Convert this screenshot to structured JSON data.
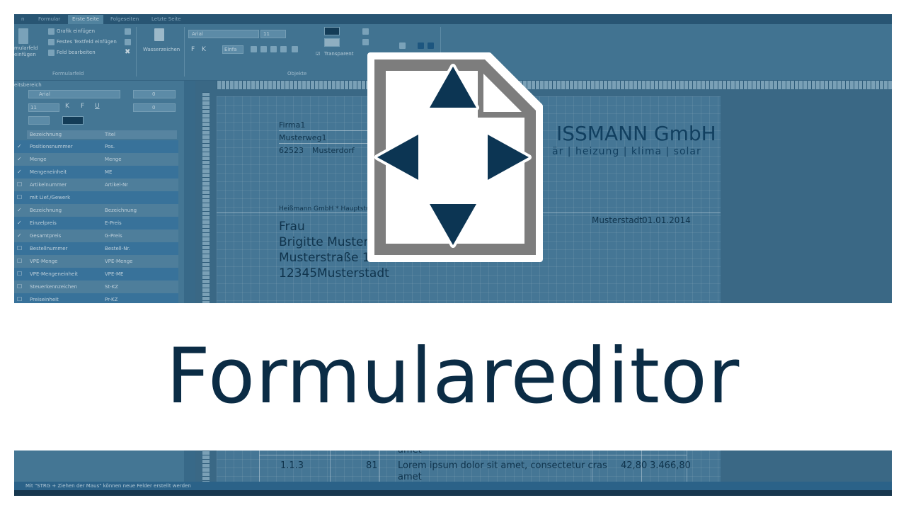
{
  "tabs": [
    "Formular",
    "Erste Seite",
    "Folgeseiten",
    "Letzte Seite"
  ],
  "ribbon": {
    "formularfeld_label": "Formularfeld",
    "insert_formfield": "mularfeld\neinfügen",
    "grafik_einfuegen": "Grafik einfügen",
    "festes_textfeld": "Festes Textfeld einfügen",
    "feld_bearbeiten": "Feld bearbeiten",
    "wasserzeichen": "Wasserzeichen",
    "font_name": "Arial",
    "font_size": "11",
    "bold": "F",
    "italic": "K",
    "underline": "U",
    "einfa": "Einfa",
    "transparent": "Transparent",
    "objekte_label": "Objekte"
  },
  "left_panel": {
    "title": "eitsbereich",
    "font_name": "Arial",
    "font_size": "11",
    "bold": "F",
    "italic": "K",
    "underline": "U",
    "spinner_value_1": "0",
    "spinner_value_2": "0",
    "header_col1": "Bezeichnung",
    "header_col2": "Titel",
    "rows": [
      {
        "name": "Positionsnummer",
        "title": "Pos.",
        "checked": true
      },
      {
        "name": "Menge",
        "title": "Menge",
        "checked": true
      },
      {
        "name": "Mengeneinheit",
        "title": "ME",
        "checked": true
      },
      {
        "name": "Artikelnummer",
        "title": "Artikel-Nr",
        "checked": false
      },
      {
        "name": "mit Lief./Gewerk",
        "title": "",
        "checked": false
      },
      {
        "name": "Bezeichnung",
        "title": "Bezeichnung",
        "checked": true
      },
      {
        "name": "Einzelpreis",
        "title": "E-Preis",
        "checked": true
      },
      {
        "name": "Gesamtpreis",
        "title": "G-Preis",
        "checked": true
      },
      {
        "name": "Bestellnummer",
        "title": "Bestell-Nr.",
        "checked": false
      },
      {
        "name": "VPE-Menge",
        "title": "VPE-Menge",
        "checked": false
      },
      {
        "name": "VPE-Mengeneinheit",
        "title": "VPE-ME",
        "checked": false
      },
      {
        "name": "Steuerkennzeichen",
        "title": "St-KZ",
        "checked": false
      },
      {
        "name": "Preiseinheit",
        "title": "Pr-KZ",
        "checked": false
      }
    ]
  },
  "document": {
    "company_line1": "Firma1",
    "company_line2": "Musterweg1",
    "zip": "62523",
    "city": "Musterdorf",
    "logo_main": "ISSMANN GmbH",
    "logo_sub": "är | heizung | klima | solar",
    "sender_line": "Heißmann GmbH * Hauptstra",
    "salutation": "Frau",
    "recipient_name": "Brigitte Musterm",
    "recipient_street": "Musterstraße 15",
    "recipient_zip": "12345",
    "recipient_city": "Musterstadt",
    "place": "Musterstadt",
    "date": "01.01.2014"
  },
  "title": "Formulareditor",
  "bottom": {
    "top_fragment": "amet",
    "position": "1.1.3",
    "quantity": "81",
    "description": "Lorem ipsum dolor sit amet, consectetur cras",
    "description_cont": "amet",
    "unit_price": "42,80",
    "total_price": "3.466,80",
    "status_text": "Mit \"STRG + Ziehen der Maus\" können neue Felder erstellt werden"
  },
  "colors": {
    "title": "#0b2c45",
    "icon_border": "#7a7a7a",
    "icon_arrow": "#0c3553",
    "overlay": "#2f607e"
  },
  "icons": [
    "document-move-icon",
    "arrow-up-icon",
    "arrow-down-icon",
    "arrow-left-icon",
    "arrow-right-icon"
  ]
}
